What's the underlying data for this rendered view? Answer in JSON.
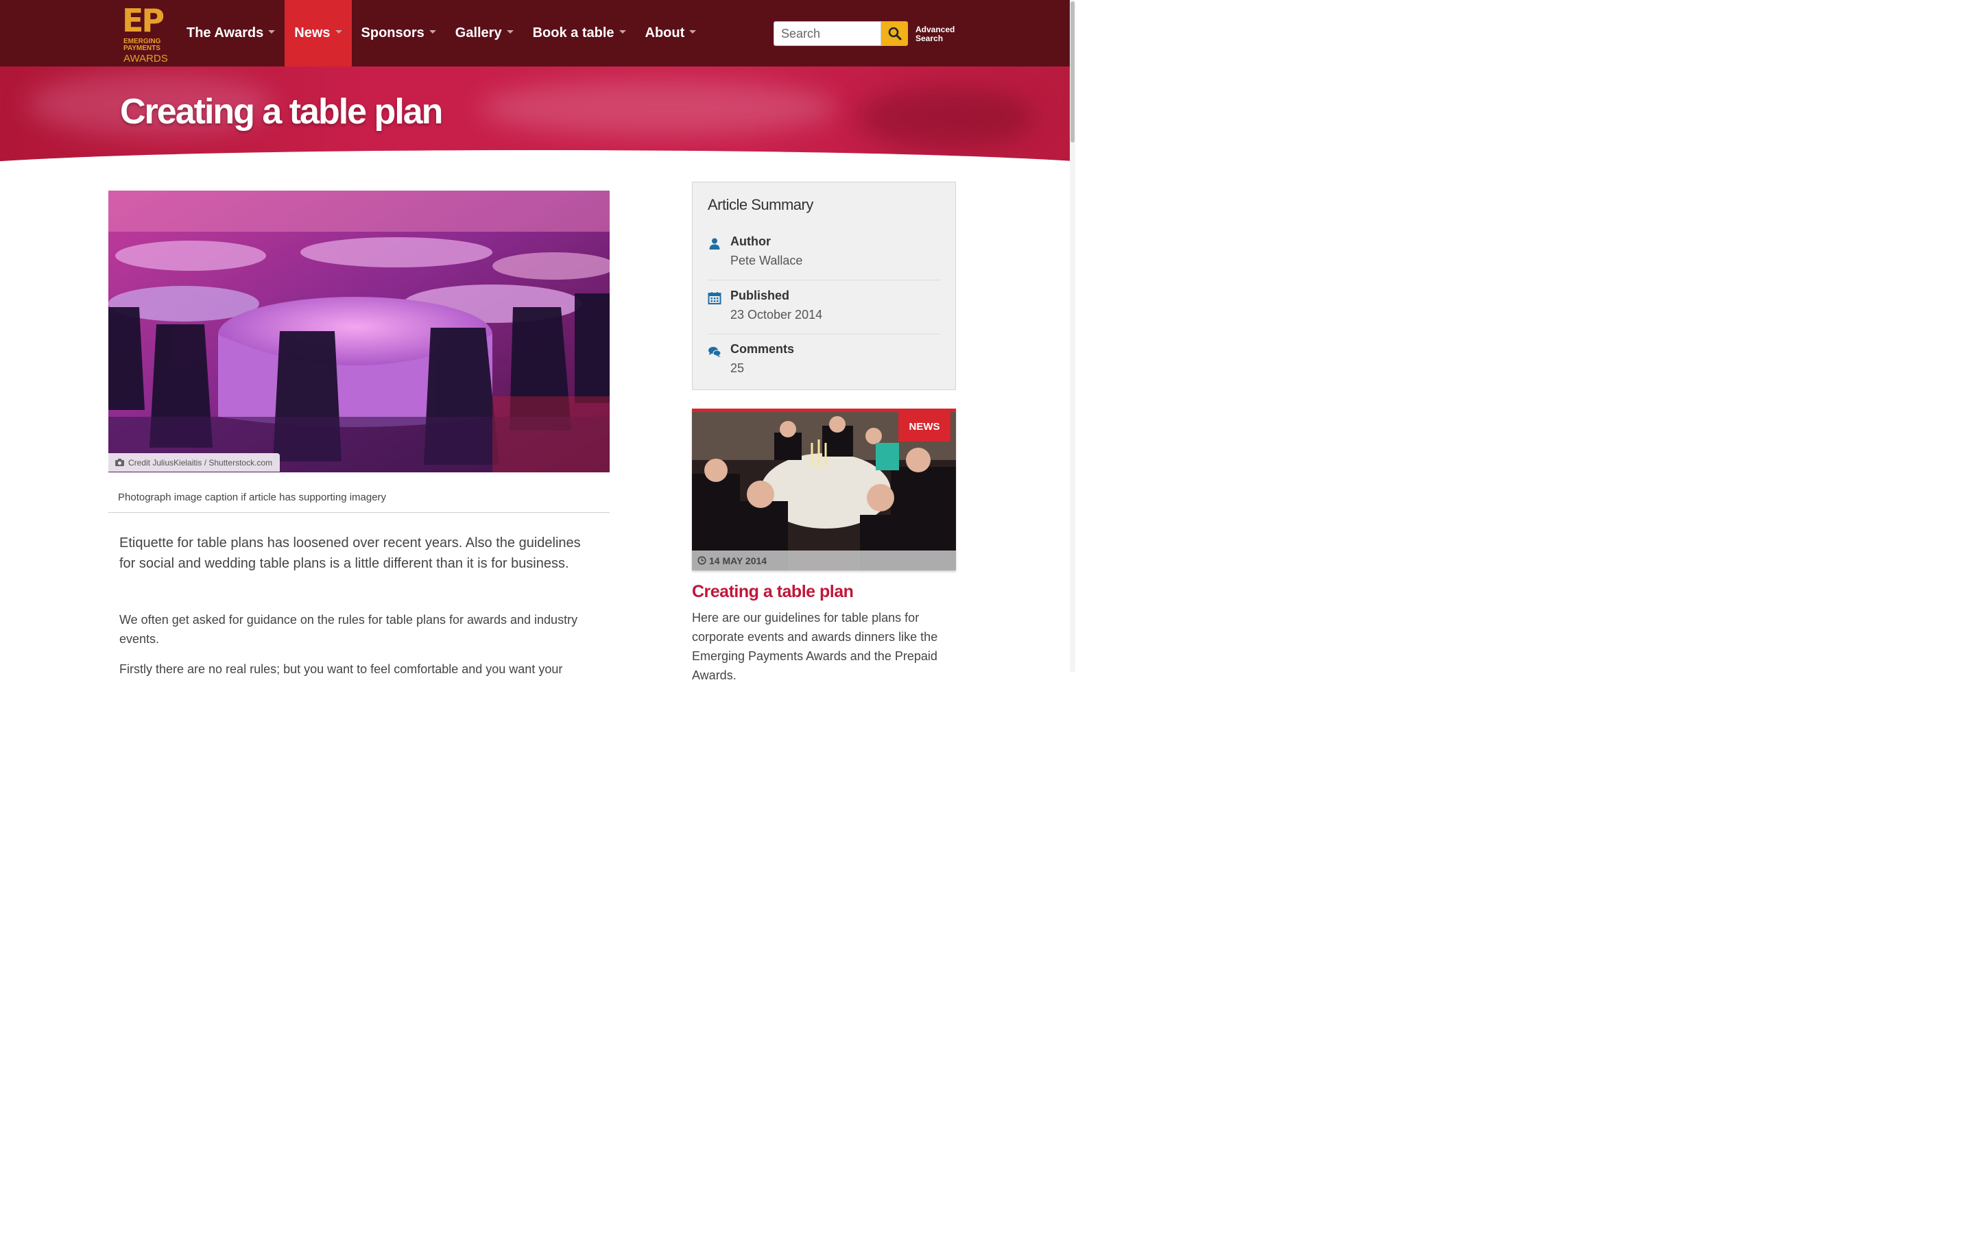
{
  "brand": {
    "logo_mark": "EP",
    "logo_line1": "EMERGING",
    "logo_line2": "PAYMENTS",
    "logo_line3": "AWARDS"
  },
  "nav": {
    "items": [
      {
        "label": "The Awards",
        "has_dropdown": true,
        "active": false
      },
      {
        "label": "News",
        "has_dropdown": true,
        "active": true
      },
      {
        "label": "Sponsors",
        "has_dropdown": true,
        "active": false
      },
      {
        "label": "Gallery",
        "has_dropdown": true,
        "active": false
      },
      {
        "label": "Book a table",
        "has_dropdown": true,
        "active": false
      },
      {
        "label": "About",
        "has_dropdown": true,
        "active": false
      }
    ]
  },
  "search": {
    "placeholder": "Search",
    "button_icon": "search-icon",
    "advanced_line1": "Advanced",
    "advanced_line2": "Search"
  },
  "hero": {
    "title": "Creating a table plan"
  },
  "article": {
    "image_credit": "Credit JuliusKielaitis / Shutterstock.com",
    "caption": "Photograph image caption if article has supporting imagery",
    "lead": "Etiquette for table plans has loosened over recent years. Also the guidelines for social and wedding table plans is a little different than it is for business.",
    "para1": "We often get asked for guidance on the rules for table plans for awards and industry events.",
    "para2": "Firstly there are no real rules; but you want to feel comfortable and you want your"
  },
  "summary": {
    "title": "Article Summary",
    "author_label": "Author",
    "author_value": "Pete Wallace",
    "published_label": "Published",
    "published_value": "23 October 2014",
    "comments_label": "Comments",
    "comments_value": "25"
  },
  "related": {
    "badge": "NEWS",
    "date": "14 MAY 2014",
    "title": "Creating a table plan",
    "excerpt": "Here are our guidelines for table plans for corporate events and awards dinners like the Emerging Payments Awards and the Prepaid Awards."
  },
  "colors": {
    "header_bg": "#5b1018",
    "accent_red": "#d7262e",
    "search_button": "#f2b019",
    "link_red": "#c0163b",
    "icon_blue": "#1e6ea6"
  }
}
